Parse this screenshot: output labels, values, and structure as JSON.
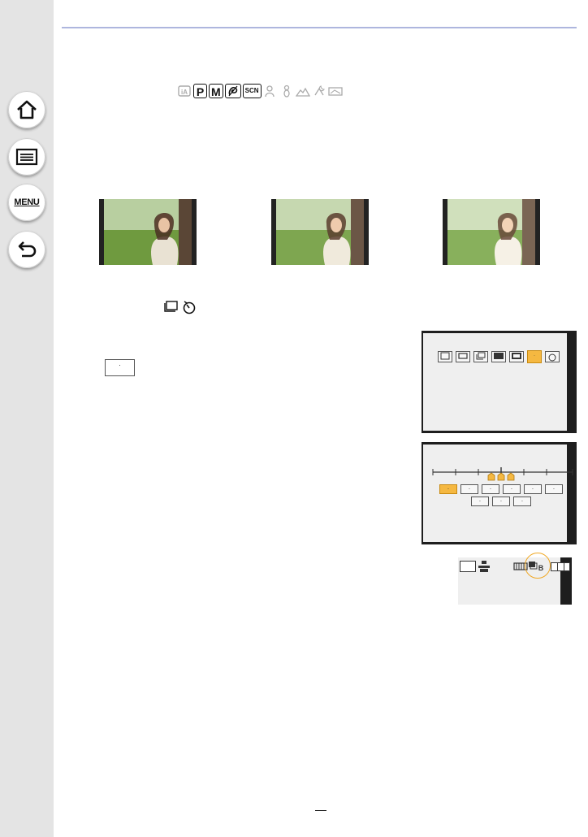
{
  "nav": {
    "home_icon": "home-icon",
    "contents_icon": "list-icon",
    "menu_label": "MENU",
    "back_icon": "return-arrow-icon"
  },
  "modes": {
    "icons": [
      "intelligent-auto-icon",
      "P",
      "M",
      "creative-control-icon",
      "SCN",
      "portrait-icon",
      "baby-icon",
      "landscape-icon",
      "night-icon",
      "panorama-icon"
    ],
    "p_label": "P",
    "m_label": "M",
    "scn_label": "SCN"
  },
  "step_screen1": {
    "selected_label": "·",
    "tile_label": "·"
  },
  "step_screen2": {
    "row1": [
      "·",
      "·",
      "·",
      "·",
      "·",
      "·"
    ],
    "row2": [
      "·",
      "·",
      "·"
    ]
  },
  "smallkey_label": "·",
  "colors": {
    "highlight": "#f5b841",
    "accent_line": "#aeb6de",
    "sidebar": "#e4e4e4"
  }
}
